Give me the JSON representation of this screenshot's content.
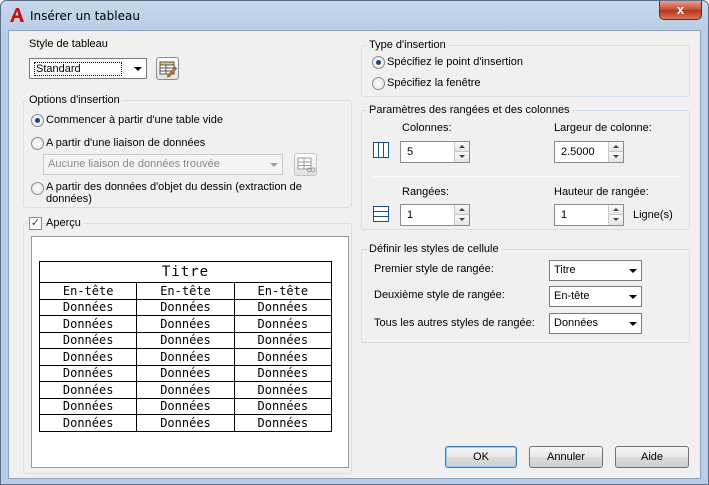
{
  "window": {
    "title": "Insérer un tableau",
    "close_glyph": "x"
  },
  "table_style": {
    "label": "Style de tableau",
    "selected": "Standard",
    "edit_icon": "table-style-edit-icon"
  },
  "insert_options": {
    "label": "Options d'insertion",
    "options": [
      {
        "label": "Commencer à partir d'une table vide",
        "selected": true
      },
      {
        "label": "A partir d'une liaison de données",
        "selected": false
      },
      {
        "label": "A partir des données d'objet du dessin (extraction de",
        "label2": "données)",
        "selected": false
      }
    ],
    "data_link_combo": "Aucune liaison de données trouvée"
  },
  "preview": {
    "label": "Aperçu",
    "checked": true,
    "table": {
      "title": "Titre",
      "headers": [
        "En-tête",
        "En-tête",
        "En-tête"
      ],
      "rows": [
        [
          "Données",
          "Données",
          "Données"
        ],
        [
          "Données",
          "Données",
          "Données"
        ],
        [
          "Données",
          "Données",
          "Données"
        ],
        [
          "Données",
          "Données",
          "Données"
        ],
        [
          "Données",
          "Données",
          "Données"
        ],
        [
          "Données",
          "Données",
          "Données"
        ],
        [
          "Données",
          "Données",
          "Données"
        ],
        [
          "Données",
          "Données",
          "Données"
        ]
      ]
    }
  },
  "insertion_type": {
    "label": "Type d'insertion",
    "options": [
      {
        "label": "Spécifiez le point d'insertion",
        "selected": true
      },
      {
        "label": "Spécifiez la fenêtre",
        "selected": false
      }
    ]
  },
  "rows_cols": {
    "label": "Paramètres des rangées et des colonnes",
    "columns_label": "Colonnes:",
    "columns_value": "5",
    "col_width_label": "Largeur de colonne:",
    "col_width_value": "2.5000",
    "rows_label": "Rangées:",
    "rows_value": "1",
    "row_height_label": "Hauteur de rangée:",
    "row_height_value": "1",
    "row_height_unit": "Ligne(s)"
  },
  "cell_styles": {
    "label": "Définir les styles de cellule",
    "first_label": "Premier style de rangée:",
    "first_value": "Titre",
    "second_label": "Deuxième style de rangée:",
    "second_value": "En-tête",
    "other_label": "Tous les autres styles de rangée:",
    "other_value": "Données"
  },
  "buttons": {
    "ok": "OK",
    "cancel": "Annuler",
    "help": "Aide"
  }
}
